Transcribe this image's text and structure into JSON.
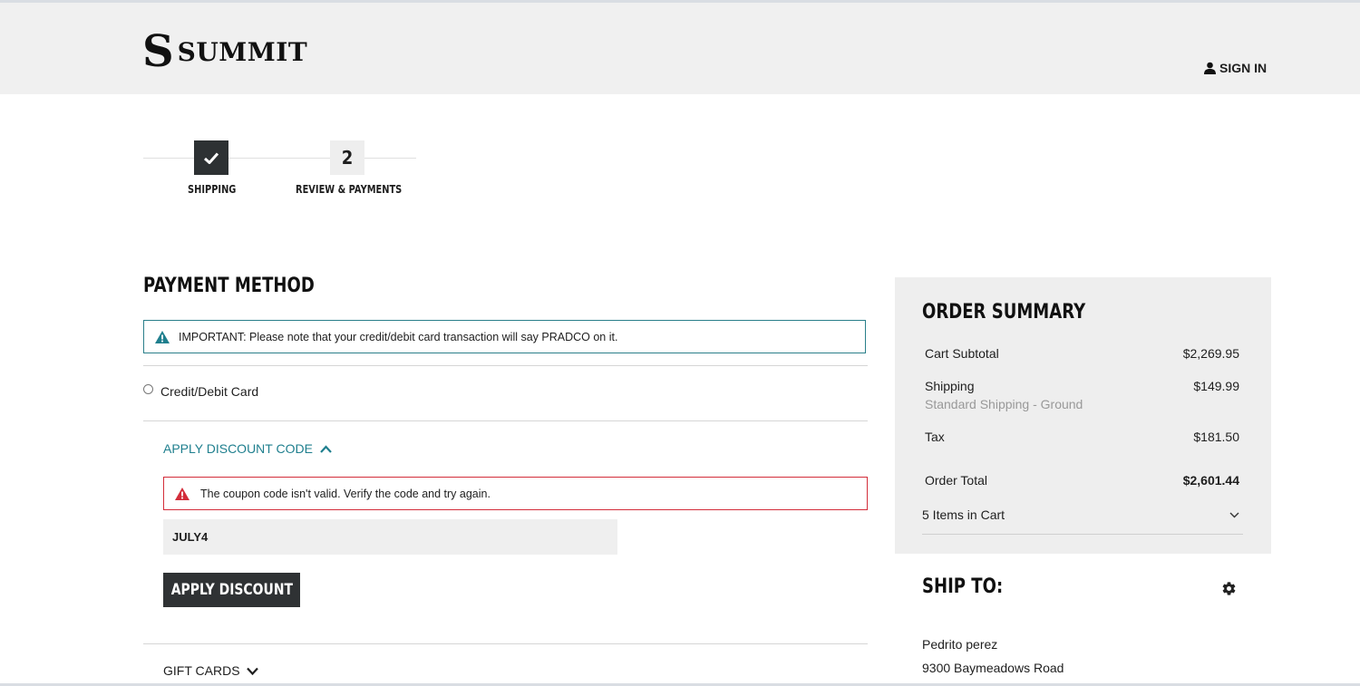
{
  "brand": {
    "logo_mark": "S",
    "name": "SUMMIT"
  },
  "header": {
    "signin_label": "SIGN IN"
  },
  "steps": [
    {
      "label": "SHIPPING",
      "state": "completed",
      "icon": "checkmark-icon"
    },
    {
      "label": "REVIEW & PAYMENTS",
      "number": "2",
      "state": "current"
    }
  ],
  "payment": {
    "title": "PAYMENT METHOD",
    "notice": "IMPORTANT: Please note that your credit/debit card transaction will say PRADCO on it.",
    "option_label": "Credit/Debit Card",
    "discount": {
      "toggle_label": "APPLY DISCOUNT CODE",
      "error": "The coupon code isn't valid. Verify the code and try again.",
      "code_value": "JULY4",
      "apply_label": "APPLY DISCOUNT"
    },
    "gift_cards_label": "GIFT CARDS"
  },
  "summary": {
    "title": "ORDER SUMMARY",
    "cart_subtotal_label": "Cart Subtotal",
    "cart_subtotal_value": "$2,269.95",
    "shipping_label": "Shipping",
    "shipping_method": "Standard Shipping - Ground",
    "shipping_value": "$149.99",
    "tax_label": "Tax",
    "tax_value": "$181.50",
    "total_label": "Order Total",
    "total_value": "$2,601.44",
    "items_label": "5 Items in Cart"
  },
  "ship_to": {
    "title": "SHIP TO:",
    "name": "Pedrito perez",
    "street": "9300 Baymeadows Road"
  },
  "colors": {
    "accent_teal": "#1f7f8e",
    "error_red": "#d32d3a",
    "dark_button": "#2f3234",
    "panel_gray": "#eeeeee"
  }
}
